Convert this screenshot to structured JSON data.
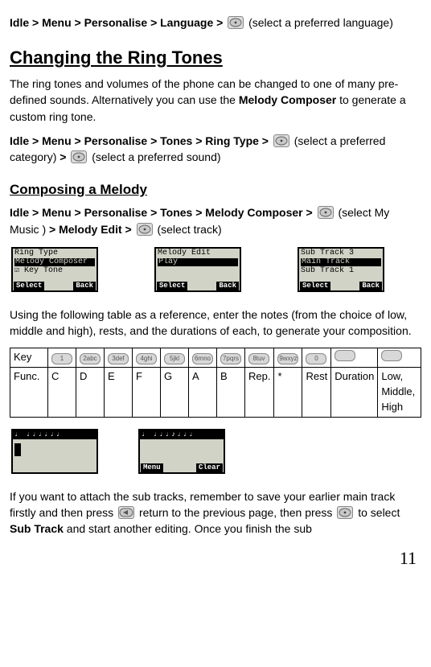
{
  "nav1": {
    "prefix": "Idle > Menu > Personalise > Language > ",
    "suffix": " (select a preferred language)"
  },
  "heading1": "Changing the Ring Tones",
  "intro": {
    "p1a": "The ring tones and volumes of the phone can be changed to one of many pre-defined sounds. Alternatively you can use the ",
    "melody_composer": "Melody Composer",
    "p1b": " to generate a custom ring tone."
  },
  "nav2": {
    "a": "Idle > Menu > Personalise > Tones > Ring Type > ",
    "b": " (select a preferred category) ",
    "gt": ">",
    "c": " (select a preferred sound)"
  },
  "heading2": "Composing a Melody",
  "nav3": {
    "a": "Idle > Menu > Personalise > Tones > Melody Composer > ",
    "b": " (select My Music ) ",
    "gt": "> ",
    "med": "Melody Edit > ",
    "c": " (select track)"
  },
  "screens1": [
    {
      "lines": [
        "Ring Type",
        {
          "hl": true,
          "text": "Melody Composer"
        },
        "☑ Key Tone"
      ],
      "soft": [
        "Select",
        "Back"
      ]
    },
    {
      "lines": [
        "Melody Edit",
        {
          "hl": true,
          "text": "Play"
        },
        ""
      ],
      "soft": [
        "Select",
        "Back"
      ]
    },
    {
      "lines": [
        "Sub Track 3",
        {
          "hl": true,
          "text": "Main Track"
        },
        "Sub Track 1"
      ],
      "soft": [
        "Select",
        "Back"
      ]
    }
  ],
  "table_intro": "Using the following table as a reference, enter the notes (from the choice of low, middle and high), rests, and the durations of each, to generate your composition.",
  "table": {
    "row1_label": "Key",
    "row2_label": "Func.",
    "keys": [
      "1",
      "2abc",
      "3def",
      "4ghi",
      "5jkl",
      "6mno",
      "7pqrs",
      "8tuv",
      "9wxyz",
      "0",
      "",
      ""
    ],
    "funcs": [
      "C",
      "D",
      "E",
      "F",
      "G",
      "A",
      "B",
      "Rep.",
      "*",
      "Rest",
      "Duration",
      "Low, Middle, High"
    ]
  },
  "screens2": [
    {
      "top": "♩    ♩♩♩♩♩♩",
      "cursor": true,
      "soft": [
        "",
        ""
      ]
    },
    {
      "top": "♩      ♩♩♩♪♩♩♩",
      "cursor": false,
      "soft": [
        "Menu",
        "Clear"
      ]
    }
  ],
  "subtrack": {
    "a": "If you want to attach the sub tracks, remember to save your earlier main track firstly and then press ",
    "b": " return to the previous page, then press ",
    "c": " to select ",
    "sub_track": "Sub Track",
    "d": " and start another editing. Once you finish the sub"
  },
  "page": "11"
}
